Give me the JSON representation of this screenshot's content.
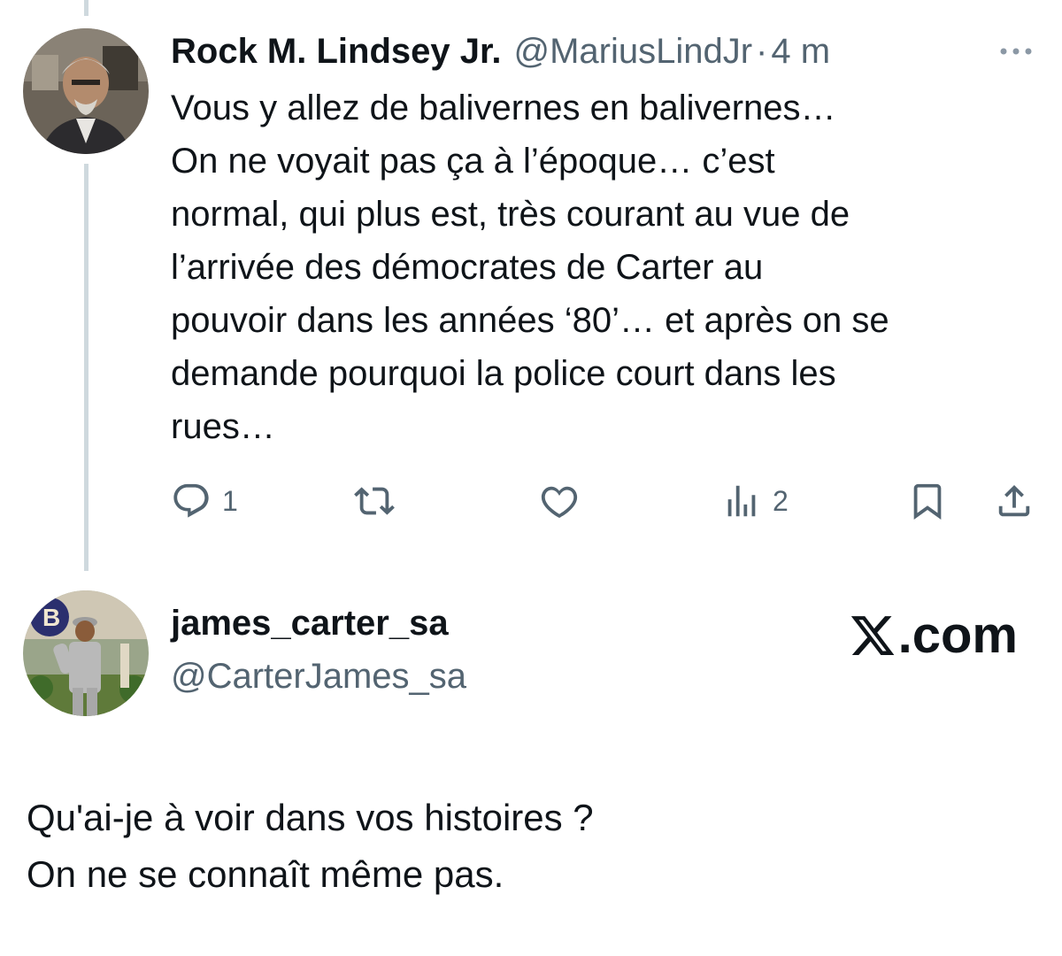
{
  "main_tweet": {
    "author": {
      "display_name": "Rock M. Lindsey Jr.",
      "handle": "@MariusLindJr",
      "separator": "·",
      "time": "4 m"
    },
    "text": "Vous y allez de balivernes en balivernes…\nOn ne voyait pas ça à l’époque… c’est\nnormal, qui plus est, très courant au vue de\nl’arrivée des démocrates de Carter au\npouvoir dans les années ‘80’… et après on se\ndemande pourquoi la police court dans les\nrues…",
    "actions": {
      "reply": {
        "icon": "reply-icon",
        "count": "1"
      },
      "retweet": {
        "icon": "retweet-icon",
        "count": ""
      },
      "like": {
        "icon": "heart-icon",
        "count": ""
      },
      "views": {
        "icon": "views-icon",
        "count": "2"
      },
      "bookmark": {
        "icon": "bookmark-icon"
      },
      "share": {
        "icon": "share-icon"
      }
    }
  },
  "quoted_post": {
    "display_name": "james_carter_sa",
    "handle": "@CarterJames_sa",
    "brand": ".com",
    "text": "Qu'ai-je à voir dans vos histoires ?\nOn ne se connaît même pas."
  },
  "colors": {
    "text_primary": "#0f1419",
    "text_secondary": "#536471",
    "thread_line": "#cfd9de",
    "background": "#ffffff"
  }
}
